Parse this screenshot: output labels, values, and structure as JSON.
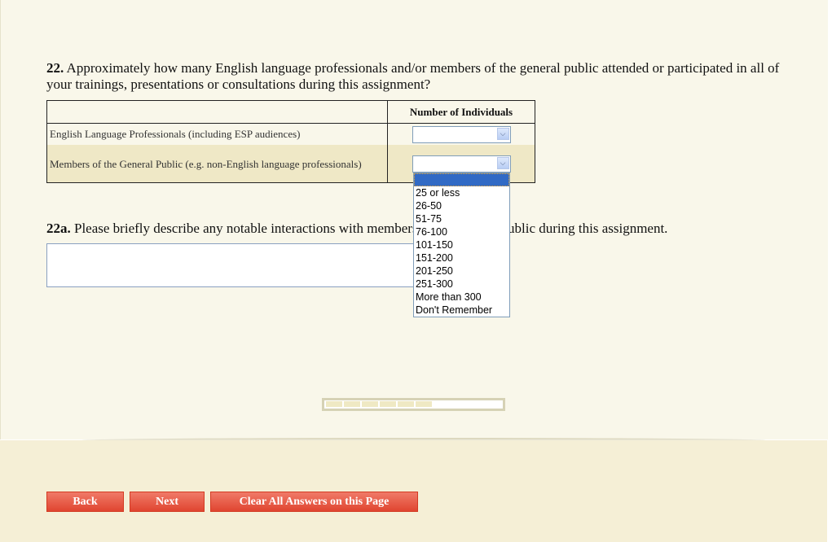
{
  "question22": {
    "number": "22.",
    "text": " Approximately how many English language professionals and/or members of the general public attended or participated in all of your trainings, presentations or consultations during this assignment?",
    "table": {
      "column_header": "Number of Individuals",
      "rows": [
        {
          "label": "English Language Professionals (including ESP audiences)",
          "value": ""
        },
        {
          "label": "Members of the General Public (e.g. non-English language professionals)",
          "value": ""
        }
      ]
    },
    "dropdown_options": [
      "",
      "25 or less",
      "26-50",
      "51-75",
      "76-100",
      "101-150",
      "151-200",
      "201-250",
      "251-300",
      "More than 300",
      "Don't Remember"
    ]
  },
  "question22a": {
    "number": "22a.",
    "text": " Please briefly describe any notable interactions with members of the general public during this assignment.",
    "value": ""
  },
  "progress": {
    "percent": 60,
    "segments_filled": 6,
    "segments_total": 10
  },
  "buttons": {
    "back": "Back",
    "next": "Next",
    "clear": "Clear All Answers on this Page"
  },
  "colors": {
    "button": "#e04530",
    "highlight": "#316ac5",
    "row_alt": "#efe8c6"
  }
}
